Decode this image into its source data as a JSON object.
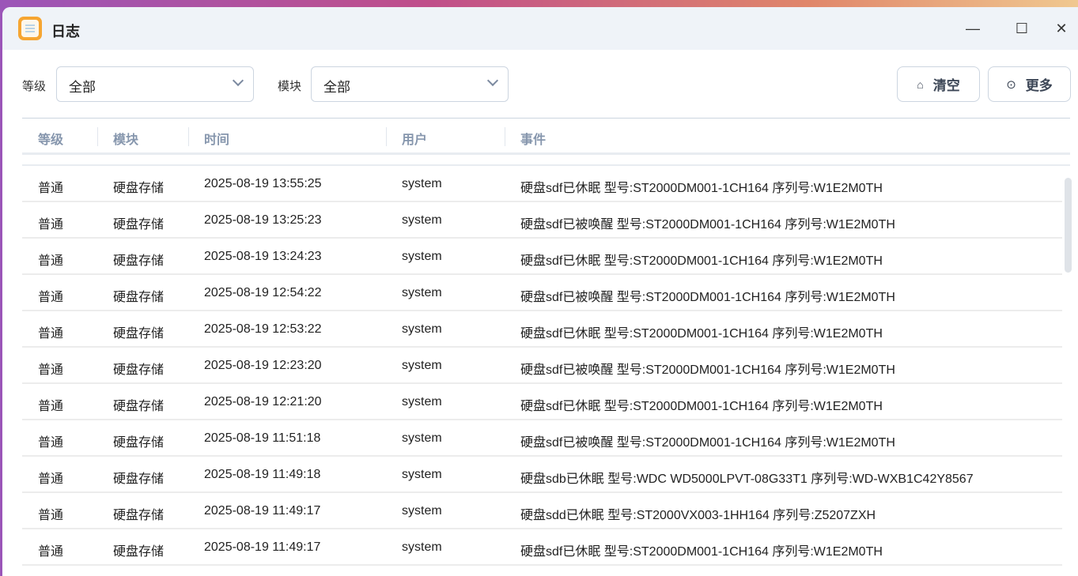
{
  "window": {
    "title": "日志",
    "minimize": "—",
    "maximize": "☐",
    "close": "✕"
  },
  "filters": {
    "level_label": "等级",
    "level_value": "全部",
    "module_label": "模块",
    "module_value": "全部"
  },
  "actions": {
    "clear": "清空",
    "more": "更多"
  },
  "table": {
    "headers": [
      "等级",
      "模块",
      "时间",
      "用户",
      "事件"
    ],
    "rows": [
      [
        "普通",
        "硬盘存储",
        "2025-08-19 13:55:25",
        "system",
        "硬盘sdf已休眠 型号:ST2000DM001-1CH164 序列号:W1E2M0TH"
      ],
      [
        "普通",
        "硬盘存储",
        "2025-08-19 13:25:23",
        "system",
        "硬盘sdf已被唤醒 型号:ST2000DM001-1CH164 序列号:W1E2M0TH"
      ],
      [
        "普通",
        "硬盘存储",
        "2025-08-19 13:24:23",
        "system",
        "硬盘sdf已休眠 型号:ST2000DM001-1CH164 序列号:W1E2M0TH"
      ],
      [
        "普通",
        "硬盘存储",
        "2025-08-19 12:54:22",
        "system",
        "硬盘sdf已被唤醒 型号:ST2000DM001-1CH164 序列号:W1E2M0TH"
      ],
      [
        "普通",
        "硬盘存储",
        "2025-08-19 12:53:22",
        "system",
        "硬盘sdf已休眠 型号:ST2000DM001-1CH164 序列号:W1E2M0TH"
      ],
      [
        "普通",
        "硬盘存储",
        "2025-08-19 12:23:20",
        "system",
        "硬盘sdf已被唤醒 型号:ST2000DM001-1CH164 序列号:W1E2M0TH"
      ],
      [
        "普通",
        "硬盘存储",
        "2025-08-19 12:21:20",
        "system",
        "硬盘sdf已休眠 型号:ST2000DM001-1CH164 序列号:W1E2M0TH"
      ],
      [
        "普通",
        "硬盘存储",
        "2025-08-19 11:51:18",
        "system",
        "硬盘sdf已被唤醒 型号:ST2000DM001-1CH164 序列号:W1E2M0TH"
      ],
      [
        "普通",
        "硬盘存储",
        "2025-08-19 11:49:18",
        "system",
        "硬盘sdb已休眠 型号:WDC WD5000LPVT-08G33T1 序列号:WD-WXB1C42Y8567"
      ],
      [
        "普通",
        "硬盘存储",
        "2025-08-19 11:49:17",
        "system",
        "硬盘sdd已休眠 型号:ST2000VX003-1HH164 序列号:Z5207ZXH"
      ],
      [
        "普通",
        "硬盘存储",
        "2025-08-19 11:49:17",
        "system",
        "硬盘sdf已休眠 型号:ST2000DM001-1CH164 序列号:W1E2M0TH"
      ]
    ]
  }
}
